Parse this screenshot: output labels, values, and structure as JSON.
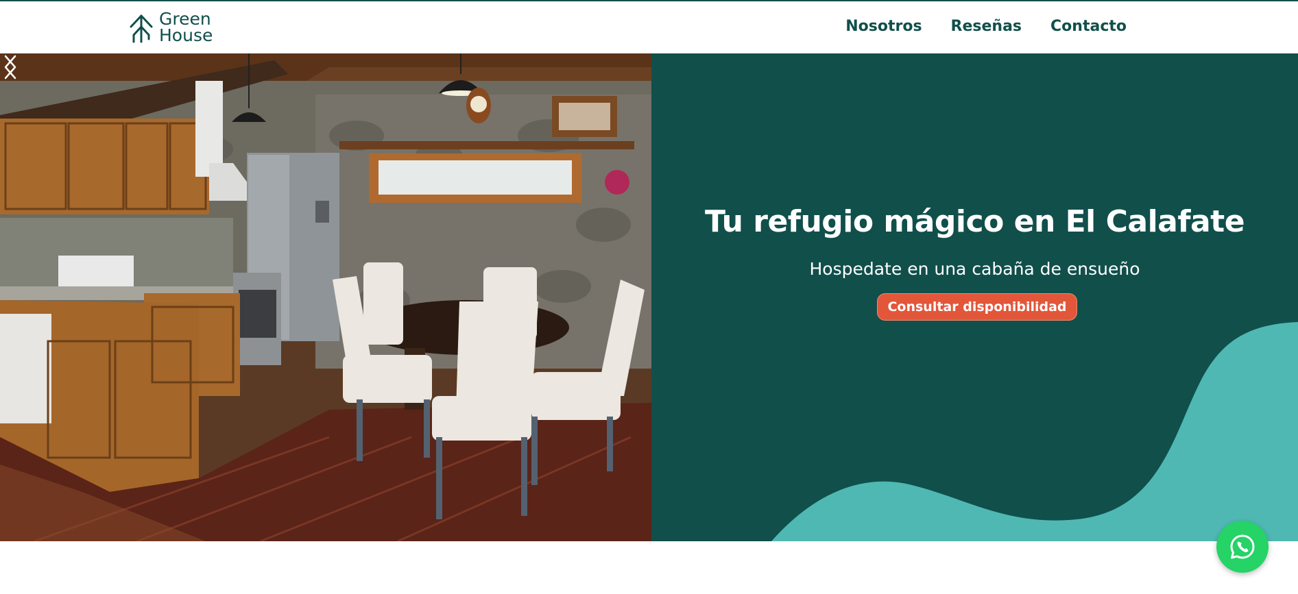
{
  "brand": {
    "logo_line1": "Green",
    "logo_line2": "House",
    "logo_icon": "tree-icon",
    "color_primary": "#114f4b",
    "color_accent": "#e2563a",
    "color_wave": "#4fb8b3"
  },
  "nav": {
    "items": [
      {
        "label": "Nosotros"
      },
      {
        "label": "Reseñas"
      },
      {
        "label": "Contacto"
      }
    ]
  },
  "hero": {
    "title": "Tu refugio mágico en El Calafate",
    "subtitle": "Hospedate en una cabaña de ensueño",
    "cta_label": "Consultar disponibilidad",
    "carousel": {
      "prev_icon": "chevron-left-icon",
      "next_icon": "chevron-right-icon"
    }
  },
  "floating": {
    "whatsapp_icon": "whatsapp-icon"
  }
}
